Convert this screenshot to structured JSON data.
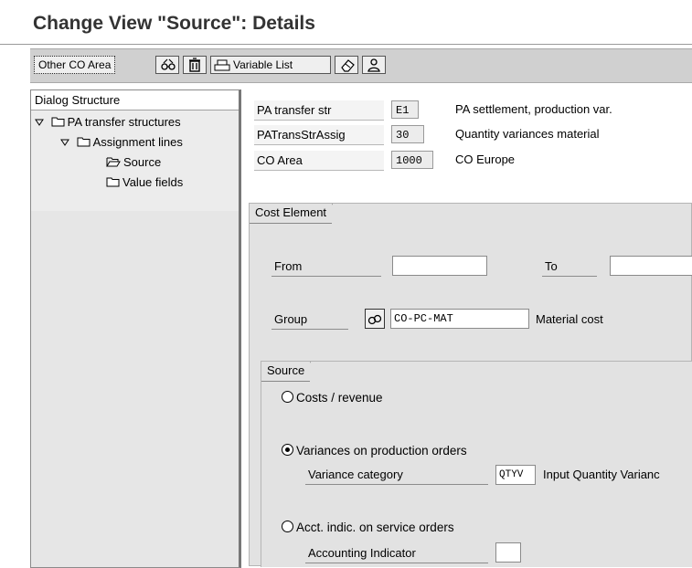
{
  "title": "Change View \"Source\": Details",
  "toolbar": {
    "other_co_area": "Other CO Area",
    "variable_list": "Variable List",
    "icons": [
      "glasses-icon",
      "trash-icon",
      "print-icon",
      "eraser-icon",
      "person-icon"
    ]
  },
  "dialog": {
    "title": "Dialog Structure",
    "items": [
      {
        "label": "PA transfer structures",
        "expanded": true
      },
      {
        "label": "Assignment lines",
        "expanded": true
      },
      {
        "label": "Source",
        "open_folder": true
      },
      {
        "label": "Value fields"
      }
    ]
  },
  "header_fields": [
    {
      "label": "PA transfer str",
      "value": "E1",
      "description": "PA settlement, production var."
    },
    {
      "label": "PATransStrAssig",
      "value": "30",
      "description": "Quantity variances material"
    },
    {
      "label": "CO Area",
      "value": "1000",
      "description": "CO Europe"
    }
  ],
  "cost_element": {
    "tab": "Cost Element",
    "from_label": "From",
    "from_value": "",
    "to_label": "To",
    "to_value": "",
    "group_label": "Group",
    "group_value": "CO-PC-MAT",
    "group_desc": "Material cost"
  },
  "source": {
    "tab": "Source",
    "options": [
      {
        "label": "Costs / revenue",
        "selected": false
      },
      {
        "label": "Variances on production orders",
        "selected": true
      },
      {
        "label": "Acct. indic. on service orders",
        "selected": false
      }
    ],
    "variance_category_label": "Variance category",
    "variance_category_value": "QTYV",
    "variance_category_desc": "Input Quantity Varianc",
    "accounting_indicator_label": "Accounting Indicator",
    "accounting_indicator_value": ""
  }
}
